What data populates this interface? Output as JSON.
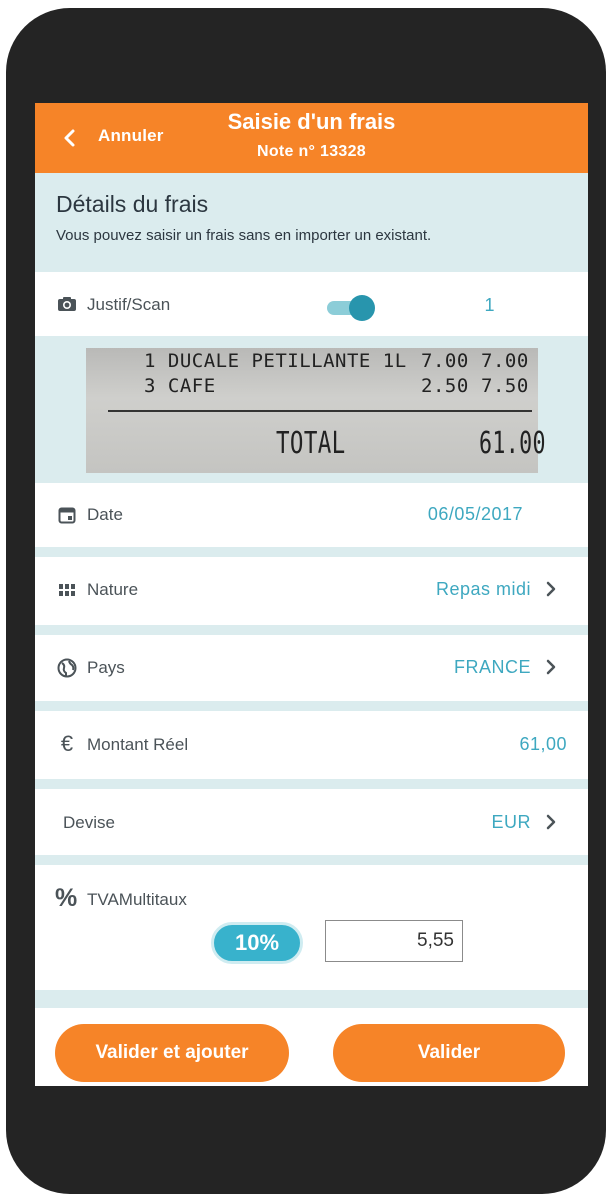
{
  "header": {
    "cancel_label": "Annuler",
    "title": "Saisie d'un frais",
    "subtitle": "Note n° 13328"
  },
  "details": {
    "heading": "Détails du frais",
    "description": "Vous pouvez saisir un frais sans en importer un existant."
  },
  "justif": {
    "label": "Justif/Scan",
    "enabled": true,
    "count": "1"
  },
  "receipt": {
    "lines": [
      {
        "desc": "1 DUCALE PETILLANTE 1L",
        "unit": "7.00",
        "total": "7.00"
      },
      {
        "desc": "3 CAFE",
        "unit": "2.50",
        "total": "7.50"
      }
    ],
    "total_label": "TOTAL",
    "total_value": "61.00"
  },
  "fields": {
    "date": {
      "label": "Date",
      "value": "06/05/2017"
    },
    "nature": {
      "label": "Nature",
      "value": "Repas midi"
    },
    "pays": {
      "label": "Pays",
      "value": "FRANCE"
    },
    "montant": {
      "label": "Montant Réel",
      "value": "61,00"
    },
    "devise": {
      "label": "Devise",
      "value": "EUR"
    }
  },
  "tva": {
    "symbol": "%",
    "label": "TVAMultitaux",
    "rate": "10%",
    "amount": "5,55"
  },
  "buttons": {
    "validate_add": "Valider et ajouter",
    "validate": "Valider"
  },
  "colors": {
    "accent": "#f68428",
    "teal": "#3ea8c0",
    "section_bg": "#dbecee"
  }
}
